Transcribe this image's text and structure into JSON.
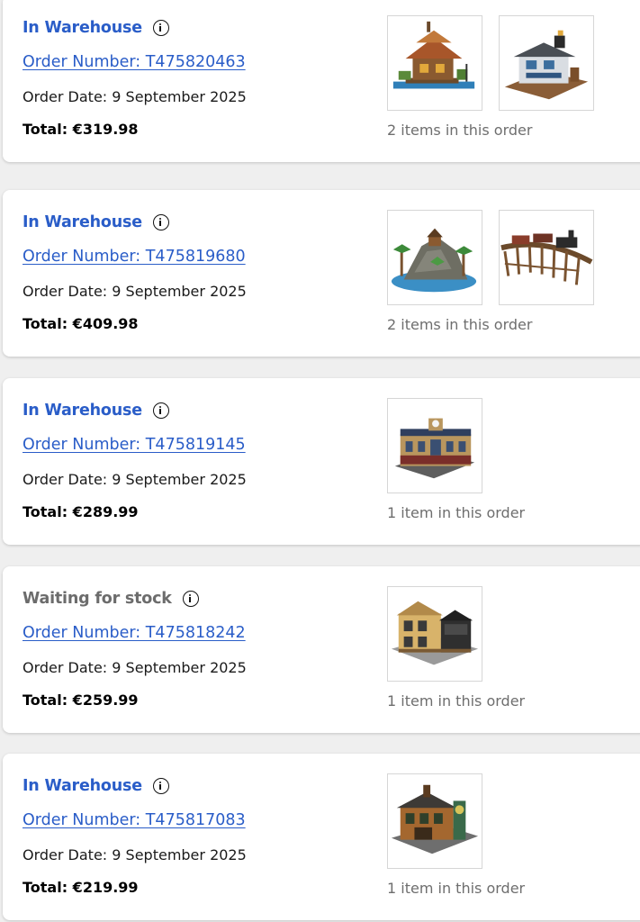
{
  "orders": [
    {
      "status": "In Warehouse",
      "status_type": "warehouse",
      "order_number_label": "Order Number: T475820463",
      "order_date": "Order Date: 9 September 2025",
      "total": "Total: €319.98",
      "items_count": "2 items in this order",
      "images": [
        "lego-floating-hut-image",
        "lego-fishing-store-image"
      ]
    },
    {
      "status": "In Warehouse",
      "status_type": "warehouse",
      "order_number_label": "Order Number: T475819680",
      "order_date": "Order Date: 9 September 2025",
      "total": "Total: €409.98",
      "items_count": "2 items in this order",
      "images": [
        "lego-pirate-island-image",
        "lego-train-trestle-image"
      ]
    },
    {
      "status": "In Warehouse",
      "status_type": "warehouse",
      "order_number_label": "Order Number: T475819145",
      "order_date": "Order Date: 9 September 2025",
      "total": "Total: €289.99",
      "items_count": "1 item in this order",
      "images": [
        "lego-train-station-image"
      ]
    },
    {
      "status": "Waiting for stock",
      "status_type": "waiting",
      "order_number_label": "Order Number: T475818242",
      "order_date": "Order Date: 9 September 2025",
      "total": "Total: €259.99",
      "items_count": "1 item in this order",
      "images": [
        "lego-tudor-building-image"
      ]
    },
    {
      "status": "In Warehouse",
      "status_type": "warehouse",
      "order_number_label": "Order Number: T475817083",
      "order_date": "Order Date: 9 September 2025",
      "total": "Total: €219.99",
      "items_count": "1 item in this order",
      "images": [
        "lego-workshop-building-image"
      ]
    }
  ],
  "colors": {
    "warehouse_status": "#2a5dc8",
    "waiting_status": "#6c6c6c",
    "link": "#2a5dc8",
    "page_background": "#efefef",
    "card_background": "#ffffff"
  },
  "icons": {
    "status_info": "info-icon"
  }
}
